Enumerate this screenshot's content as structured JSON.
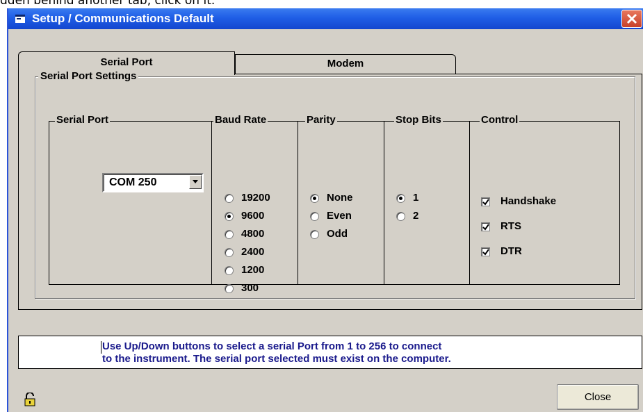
{
  "top_fragment": "dden behind another tab, click on it.",
  "window": {
    "title": "Setup / Communications Default"
  },
  "tabs": [
    {
      "label": "Serial Port",
      "active": true
    },
    {
      "label": "Modem",
      "active": false
    }
  ],
  "settings": {
    "group_label": "Serial Port Settings",
    "serial_port": {
      "label": "Serial Port",
      "selected": "COM 250"
    },
    "baud_rate": {
      "label": "Baud Rate",
      "options": [
        "19200",
        "9600",
        "4800",
        "2400",
        "1200",
        "300"
      ],
      "selected": "9600"
    },
    "parity": {
      "label": "Parity",
      "options": [
        "None",
        "Even",
        "Odd"
      ],
      "selected": "None"
    },
    "stop_bits": {
      "label": "Stop Bits",
      "options": [
        "1",
        "2"
      ],
      "selected": "1"
    },
    "control": {
      "label": "Control",
      "items": [
        {
          "label": "Handshake",
          "checked": true
        },
        {
          "label": "RTS",
          "checked": true
        },
        {
          "label": "DTR",
          "checked": true
        }
      ]
    }
  },
  "info": {
    "line1": "Use Up/Down buttons to select a serial Port from 1 to 256 to connect",
    "line2": "to the instrument. The serial port selected must exist on the computer."
  },
  "buttons": {
    "close": "Close"
  }
}
